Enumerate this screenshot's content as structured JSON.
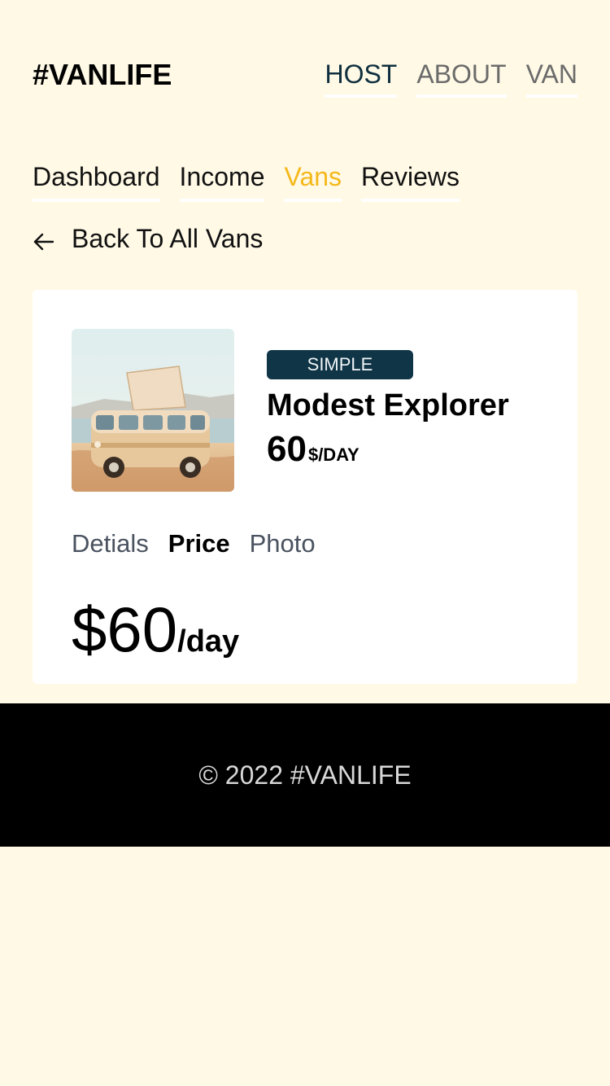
{
  "header": {
    "logo": "#VANLIFE",
    "nav": [
      {
        "label": "HOST",
        "active": true
      },
      {
        "label": "ABOUT",
        "active": false
      },
      {
        "label": "VAN",
        "active": false
      }
    ]
  },
  "host_nav": {
    "items": [
      {
        "label": "Dashboard",
        "active": false
      },
      {
        "label": "Income",
        "active": false
      },
      {
        "label": "Vans",
        "active": true
      },
      {
        "label": "Reviews",
        "active": false
      }
    ]
  },
  "back_link": {
    "label": "Back To All Vans",
    "icon": "arrow-left-icon"
  },
  "van": {
    "image_alt": "Beige camper van parked by the sea",
    "type_badge": "SIMPLE",
    "name": "Modest Explorer",
    "price_value": "60",
    "price_unit": "$/DAY"
  },
  "detail_tabs": [
    {
      "label": "Detials",
      "active": false
    },
    {
      "label": "Price",
      "active": true
    },
    {
      "label": "Photo",
      "active": false
    }
  ],
  "price_panel": {
    "amount": "$60",
    "unit": "/day"
  },
  "footer": {
    "text": "© 2022 #VANLIFE"
  },
  "colors": {
    "page_bg": "#FFF9E6",
    "accent_active": "#F5B81A",
    "badge_bg": "#0F3547",
    "footer_bg": "#000000"
  }
}
